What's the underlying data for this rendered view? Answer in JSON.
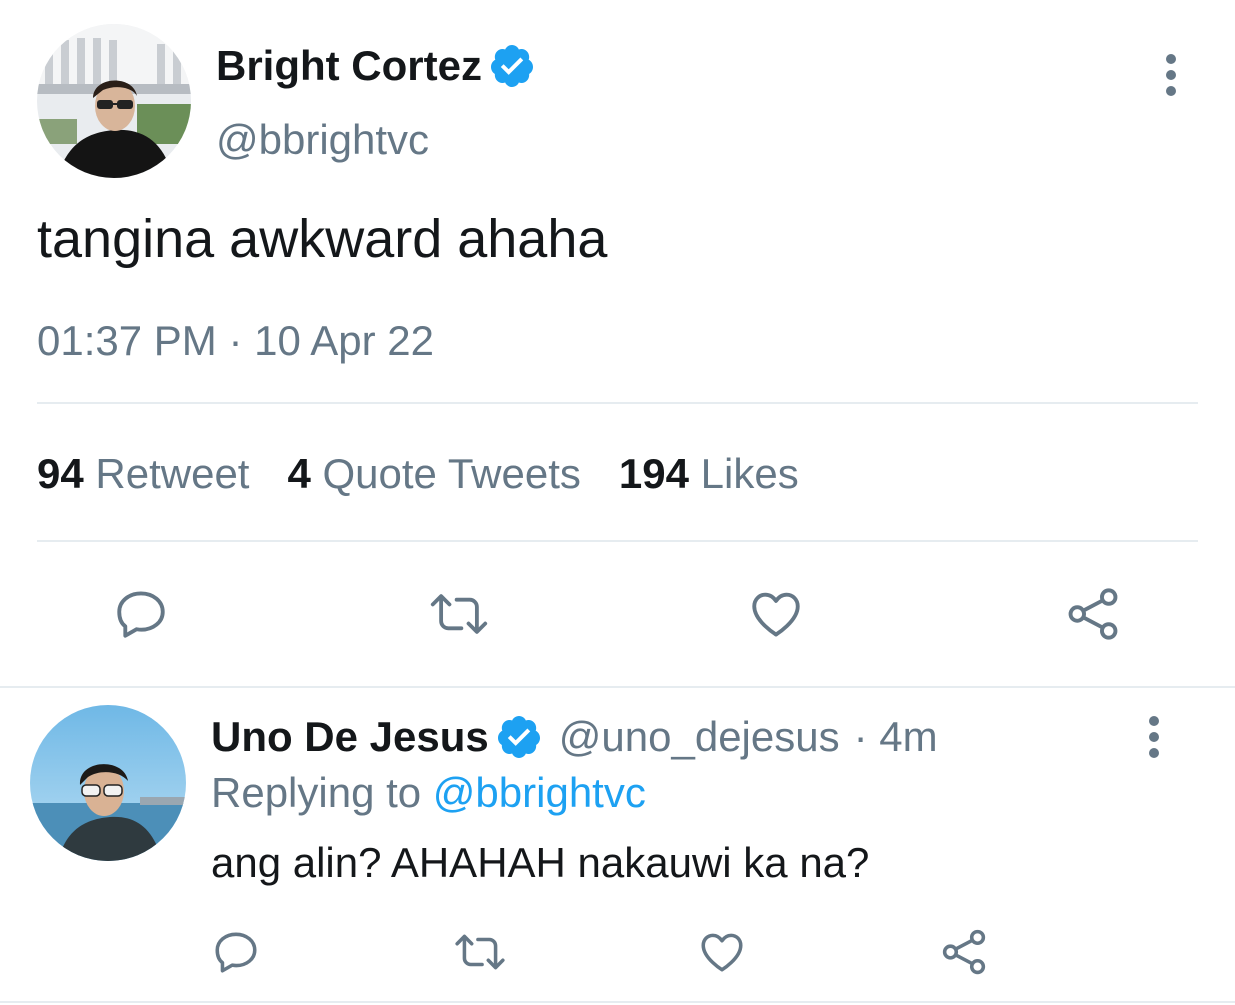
{
  "tweet": {
    "author": {
      "name": "Bright Cortez",
      "handle": "@bbrightvc",
      "verified": true
    },
    "text": "tangina awkward ahaha",
    "time": "01:37 PM",
    "separator": "·",
    "date": "10 Apr 22",
    "stats": {
      "retweets_count": "94",
      "retweets_label": "Retweet",
      "quotes_count": "4",
      "quotes_label": "Quote Tweets",
      "likes_count": "194",
      "likes_label": "Likes"
    }
  },
  "reply": {
    "author": {
      "name": "Uno De Jesus",
      "handle": "@uno_dejesus",
      "verified": true
    },
    "age": "· 4m",
    "replying_prefix": "Replying to",
    "replying_to": "@bbrightvc",
    "text": "ang alin? AHAHAH nakauwi ka na?"
  },
  "icons": {
    "more": "more-vertical-icon",
    "reply": "reply-icon",
    "retweet": "retweet-icon",
    "like": "heart-icon",
    "share": "share-icon",
    "verified": "verified-badge-icon"
  },
  "colors": {
    "accent": "#1da1f2",
    "muted": "#657786",
    "text": "#14171a",
    "divider": "#e6ecf0"
  }
}
